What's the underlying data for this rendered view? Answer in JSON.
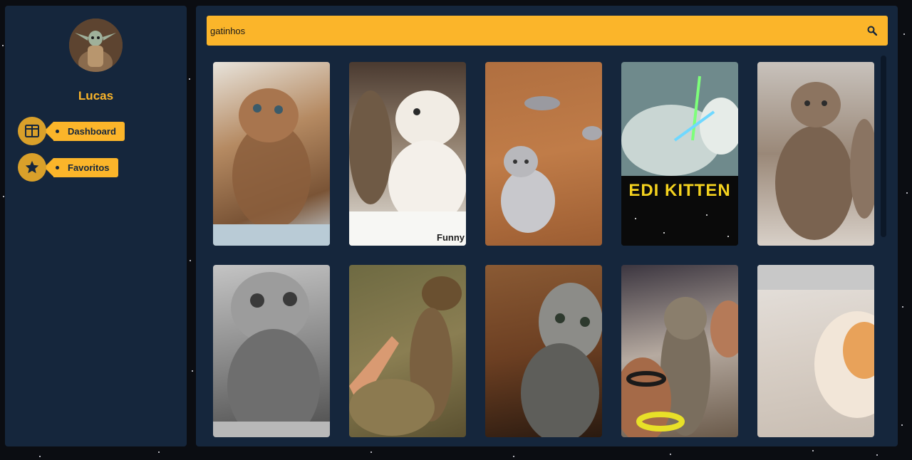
{
  "user": {
    "name": "Lucas",
    "avatar_icon": "avatar-baby-yoda"
  },
  "nav": {
    "items": [
      {
        "label": "Dashboard",
        "icon": "dashboard-icon"
      },
      {
        "label": "Favoritos",
        "icon": "star-icon"
      }
    ]
  },
  "search": {
    "value": "gatinhos",
    "icon": "search-icon"
  },
  "gallery": {
    "items": [
      {
        "alt": "fluffy kitten looking up"
      },
      {
        "alt": "two kittens facing each other",
        "caption": "Funny"
      },
      {
        "alt": "kitten on wooden floor"
      },
      {
        "alt": "jedi kitten",
        "caption": "EDI KITTEN"
      },
      {
        "alt": "tabby kitten looking up"
      },
      {
        "alt": "grey kitten"
      },
      {
        "alt": "kitten paw"
      },
      {
        "alt": "tabby cat standing"
      },
      {
        "alt": "kitten held in hands"
      },
      {
        "alt": "fluffy orange kitten"
      }
    ]
  },
  "colors": {
    "accent": "#fbb52a",
    "panel": "#15263c",
    "background": "#0b0d12"
  }
}
